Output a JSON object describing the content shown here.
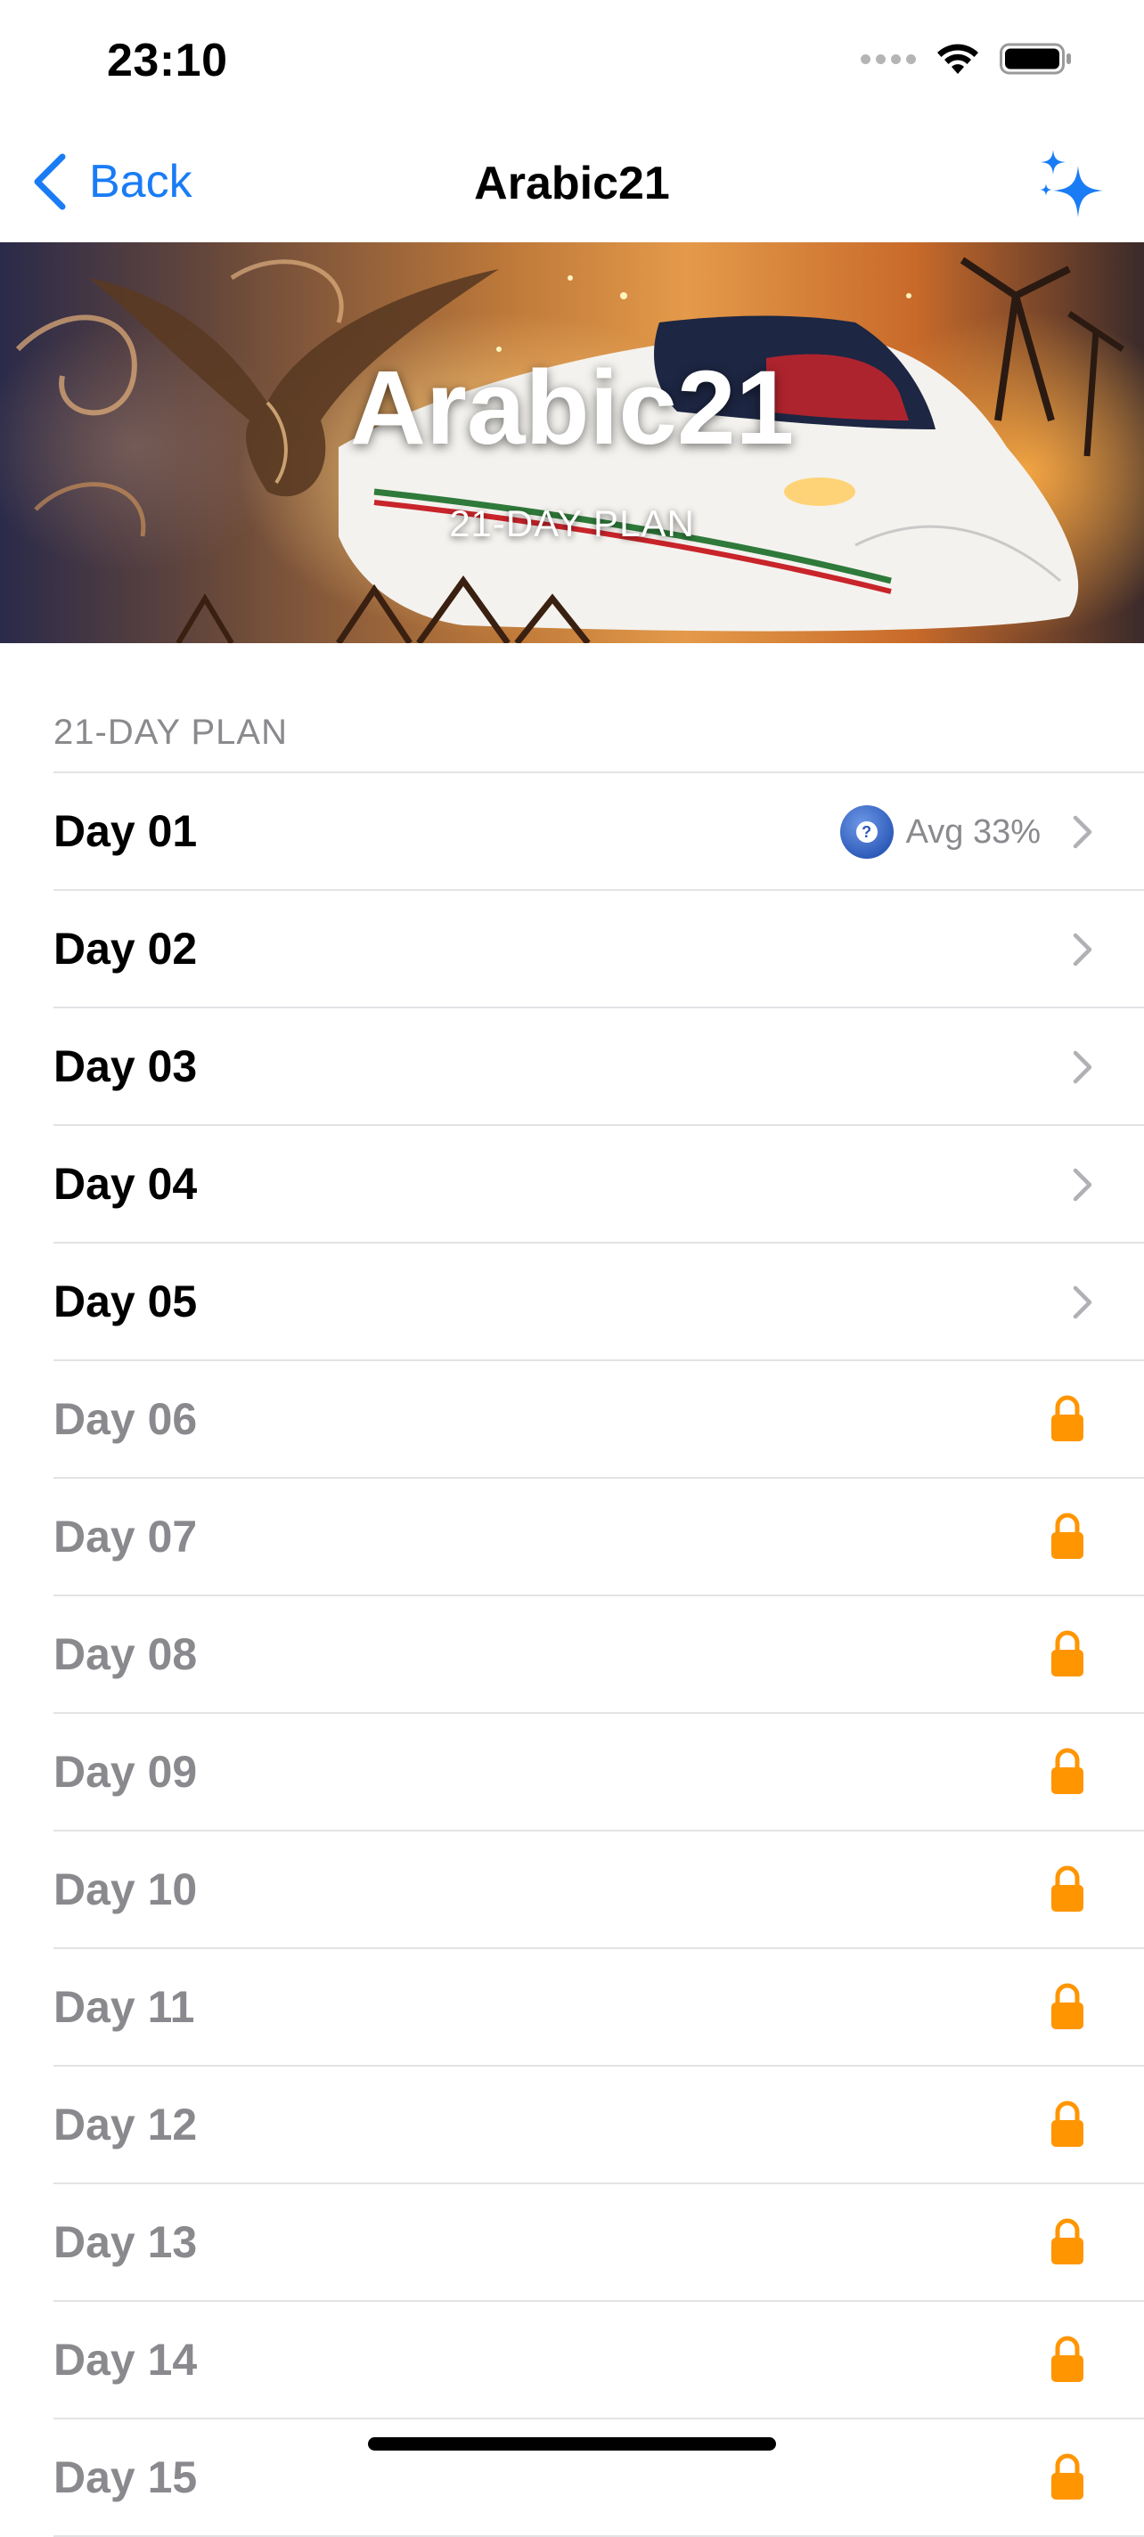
{
  "status_bar": {
    "time": "23:10"
  },
  "nav": {
    "back_label": "Back",
    "title": "Arabic21",
    "accent_color": "#1a7cf5",
    "right_icon": "sparkles-icon"
  },
  "hero": {
    "title": "Arabic21",
    "subtitle": "21-DAY PLAN"
  },
  "section": {
    "header": "21-DAY PLAN"
  },
  "days": [
    {
      "label": "Day 01",
      "locked": false,
      "badge": "Avg 33%"
    },
    {
      "label": "Day 02",
      "locked": false
    },
    {
      "label": "Day 03",
      "locked": false
    },
    {
      "label": "Day 04",
      "locked": false
    },
    {
      "label": "Day 05",
      "locked": false
    },
    {
      "label": "Day 06",
      "locked": true
    },
    {
      "label": "Day 07",
      "locked": true
    },
    {
      "label": "Day 08",
      "locked": true
    },
    {
      "label": "Day 09",
      "locked": true
    },
    {
      "label": "Day 10",
      "locked": true
    },
    {
      "label": "Day 11",
      "locked": true
    },
    {
      "label": "Day 12",
      "locked": true
    },
    {
      "label": "Day 13",
      "locked": true
    },
    {
      "label": "Day 14",
      "locked": true
    },
    {
      "label": "Day 15",
      "locked": true
    }
  ],
  "colors": {
    "lock": "#ff9500",
    "chevron": "#b0b0b5",
    "locked_text": "#8a8a8e"
  }
}
